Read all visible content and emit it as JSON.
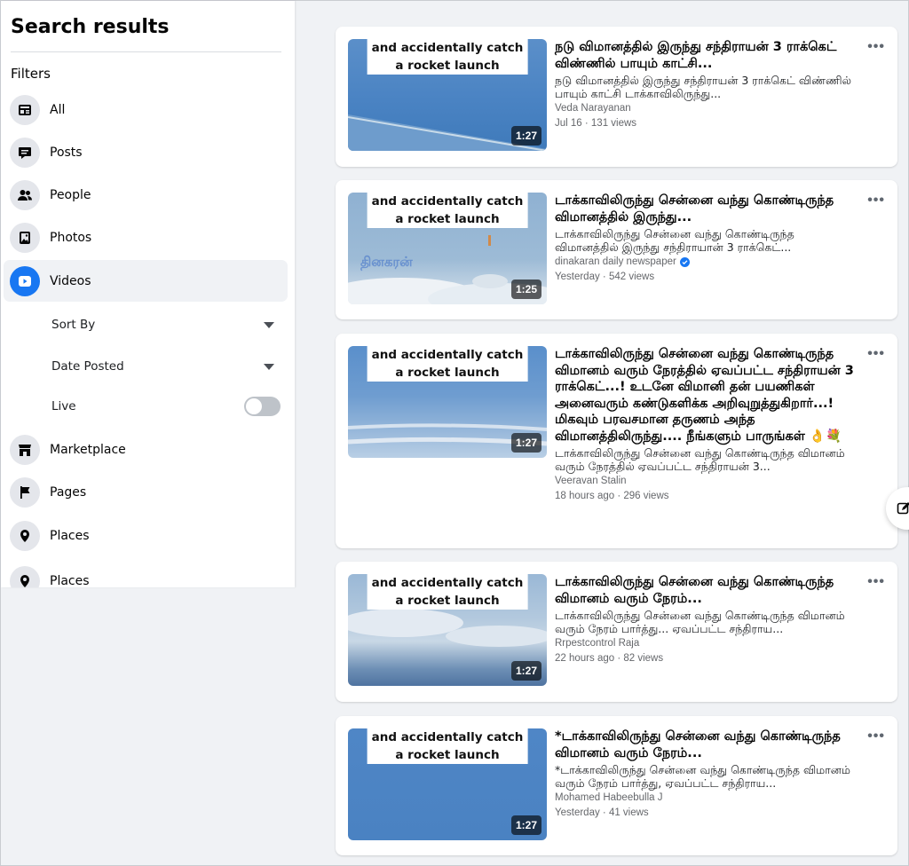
{
  "sidebar": {
    "title": "Search results",
    "filters_label": "Filters",
    "items": [
      {
        "label": "All"
      },
      {
        "label": "Posts"
      },
      {
        "label": "People"
      },
      {
        "label": "Photos"
      },
      {
        "label": "Videos"
      },
      {
        "label": "Marketplace"
      },
      {
        "label": "Pages"
      },
      {
        "label": "Places"
      },
      {
        "label": "Places"
      }
    ],
    "sub": {
      "sort_by": "Sort By",
      "date_posted": "Date Posted",
      "live": "Live"
    }
  },
  "colors": {
    "accent": "#1877f2",
    "background": "#f0f2f5",
    "secondary_text": "#65676b"
  },
  "results": [
    {
      "caption1": "and accidentally catch",
      "caption2": "a rocket launch",
      "duration": "1:27",
      "title": "நடு விமானத்தில் இருந்து சந்திராயன் 3 ராக்கெட் விண்ணில் பாயும் காட்சி...",
      "desc": "நடு விமானத்தில் இருந்து சந்திராயன் 3 ராக்கெட் விண்ணில் பாயும் காட்சி டாக்காவிலிருந்து...",
      "author": "Veda Narayanan",
      "meta": "Jul 16 · 131 views"
    },
    {
      "caption1": "and accidentally catch",
      "caption2": "a rocket launch",
      "duration": "1:25",
      "title": "டாக்காவிலிருந்து சென்னை வந்து கொண்டிருந்த விமானத்தில் இருந்து...",
      "desc": "டாக்காவிலிருந்து சென்னை வந்து கொண்டிருந்த விமானத்தில் இருந்து சந்திராயான் 3 ராக்கெட்...",
      "author": "dinakaran daily newspaper",
      "meta": "Yesterday · 542 views",
      "watermark": "தினகரன்"
    },
    {
      "caption1": "and accidentally catch",
      "caption2": "a rocket launch",
      "duration": "1:27",
      "title": "டாக்காவிலிருந்து சென்னை வந்து கொண்டிருந்த விமானம் வரும் நேரத்தில் ஏவப்பட்ட சந்திராயன் 3 ராக்கெட்...! உடனே விமானி தன் பயணிகள் அனைவரும் கண்டுகளிக்க அறிவுறுத்துகிறார்...! மிகவும் பரவசமான தருணம் அந்த விமானத்திலிருந்து.... நீங்களும் பாருங்கள் 👌💐",
      "desc": "டாக்காவிலிருந்து சென்னை வந்து கொண்டிருந்த விமானம் வரும் நேரத்தில் ஏவப்பட்ட சந்திராயன் 3...",
      "author": "Veeravan Stalin",
      "meta": "18 hours ago · 296 views"
    },
    {
      "caption1": "and accidentally catch",
      "caption2": "a rocket launch",
      "duration": "1:27",
      "title": "டாக்காவிலிருந்து சென்னை வந்து கொண்டிருந்த விமானம் வரும் நேரம்...",
      "desc": "டாக்காவிலிருந்து சென்னை வந்து கொண்டிருந்த விமானம் வரும் நேரம் பார்த்து... ஏவப்பட்ட சந்திராய...",
      "author": "Rrpestcontrol Raja",
      "meta": "22 hours ago · 82 views"
    },
    {
      "caption1": "and accidentally catch",
      "caption2": "a rocket launch",
      "duration": "1:27",
      "title": "*டாக்காவிலிருந்து சென்னை வந்து கொண்டிருந்த விமானம் வரும் நேரம்...",
      "desc": "*டாக்காவிலிருந்து சென்னை வந்து கொண்டிருந்த விமானம் வரும் நேரம் பார்த்து, ஏவப்பட்ட சந்திராய...",
      "author": "Mohamed Habeebulla J",
      "meta": "Yesterday · 41 views"
    }
  ]
}
